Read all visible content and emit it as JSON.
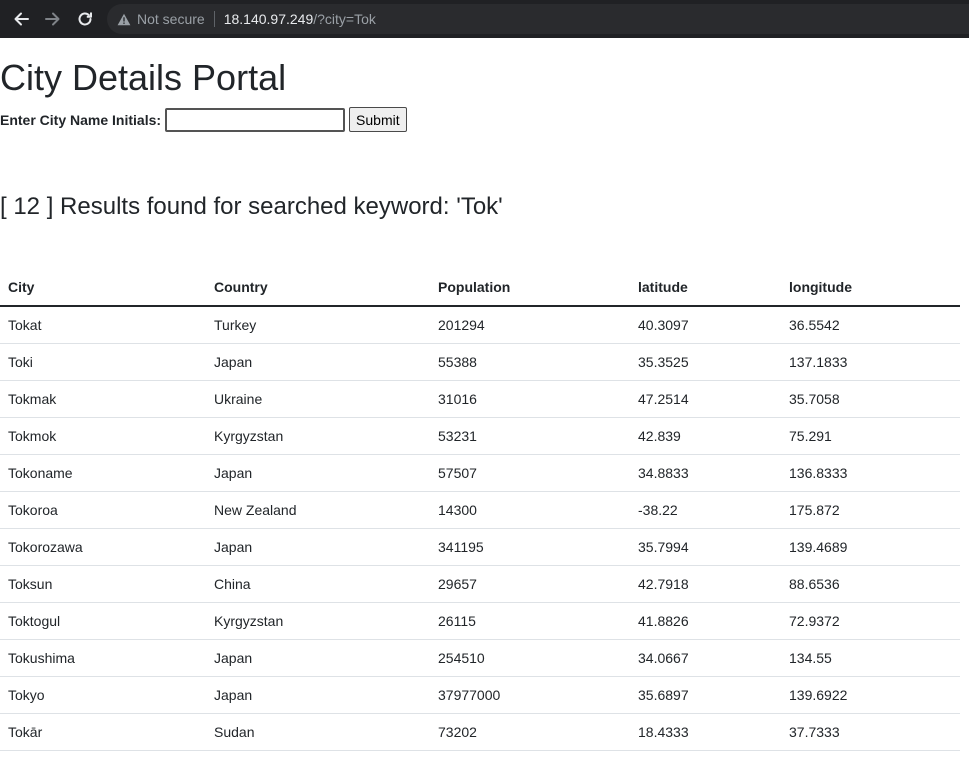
{
  "browser": {
    "security_text": "Not secure",
    "url_host": "18.140.97.249",
    "url_path": "/?city=Tok"
  },
  "page": {
    "title": "City Details Portal",
    "search": {
      "label": "Enter City Name Initials:",
      "value": "",
      "placeholder": "",
      "submit_label": "Submit"
    },
    "results_heading": "[ 12 ] Results found for searched keyword: 'Tok'"
  },
  "table": {
    "headers": [
      "City",
      "Country",
      "Population",
      "latitude",
      "longitude"
    ],
    "rows": [
      [
        "Tokat",
        "Turkey",
        "201294",
        "40.3097",
        "36.5542"
      ],
      [
        "Toki",
        "Japan",
        "55388",
        "35.3525",
        "137.1833"
      ],
      [
        "Tokmak",
        "Ukraine",
        "31016",
        "47.2514",
        "35.7058"
      ],
      [
        "Tokmok",
        "Kyrgyzstan",
        "53231",
        "42.839",
        "75.291"
      ],
      [
        "Tokoname",
        "Japan",
        "57507",
        "34.8833",
        "136.8333"
      ],
      [
        "Tokoroa",
        "New Zealand",
        "14300",
        "-38.22",
        "175.872"
      ],
      [
        "Tokorozawa",
        "Japan",
        "341195",
        "35.7994",
        "139.4689"
      ],
      [
        "Toksun",
        "China",
        "29657",
        "42.7918",
        "88.6536"
      ],
      [
        "Toktogul",
        "Kyrgyzstan",
        "26115",
        "41.8826",
        "72.9372"
      ],
      [
        "Tokushima",
        "Japan",
        "254510",
        "34.0667",
        "134.55"
      ],
      [
        "Tokyo",
        "Japan",
        "37977000",
        "35.6897",
        "139.6922"
      ],
      [
        "Tokār",
        "Sudan",
        "73202",
        "18.4333",
        "37.7333"
      ]
    ]
  },
  "icons": {
    "back": "arrow-left-icon",
    "forward": "arrow-right-icon",
    "reload": "reload-icon",
    "warning": "warning-triangle-icon"
  }
}
